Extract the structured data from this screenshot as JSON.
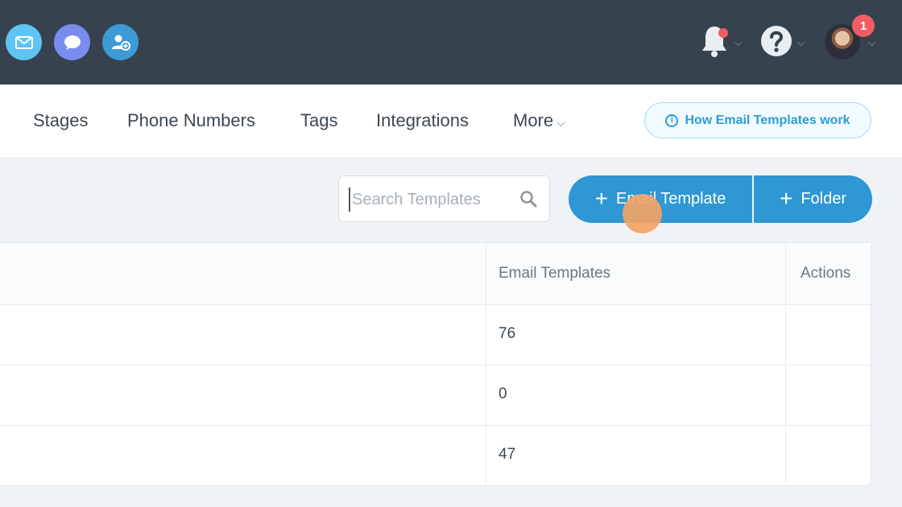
{
  "topbar": {
    "icons": [
      "email-icon",
      "chat-icon",
      "user-plus-icon"
    ],
    "notification_icon": "bell-icon",
    "help_icon": "question-icon",
    "avatar_badge": "1",
    "colors": {
      "background": "#36434f",
      "email": "#5fc3f3",
      "chat": "#7b8cf0",
      "user": "#3c9ad6",
      "badge": "#f25c63"
    }
  },
  "subnav": {
    "items": [
      "Stages",
      "Phone Numbers",
      "Tags",
      "Integrations",
      "More"
    ],
    "help_button": "How Email Templates work"
  },
  "search": {
    "placeholder": "Search Templates",
    "value": ""
  },
  "actions": {
    "email_template": "Email Template",
    "folder": "Folder"
  },
  "table": {
    "columns": [
      "Email Templates",
      "Actions"
    ],
    "rows": [
      {
        "email_templates": "76"
      },
      {
        "email_templates": "0"
      },
      {
        "email_templates": "47"
      }
    ]
  },
  "colors": {
    "accent": "#2e97d4",
    "link": "#2b9fd2"
  }
}
